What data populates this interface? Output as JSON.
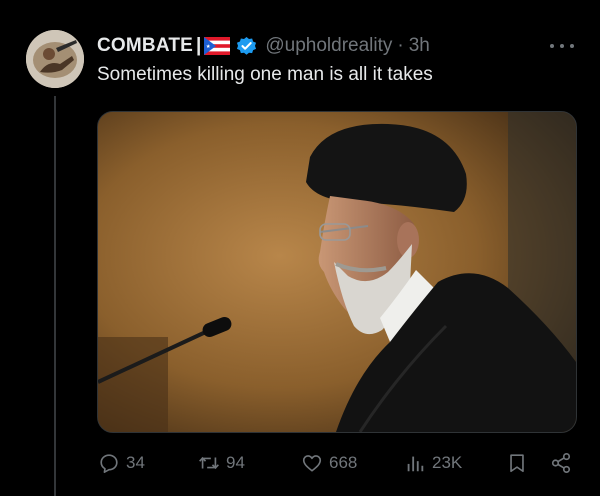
{
  "colors": {
    "background": "#000000",
    "text_primary": "#e7e9ea",
    "text_secondary": "#71767b",
    "verified_badge": "#1d9bf0"
  },
  "author": {
    "display_name": "COMBATE",
    "separator": "|",
    "flag": "puerto-rico-flag",
    "verified": true,
    "handle": "@upholdreality",
    "time_separator": "·",
    "timestamp": "3h"
  },
  "tweet": {
    "text": "Sometimes killing one man is all it takes"
  },
  "media": {
    "type": "photo"
  },
  "actions": {
    "reply_count": "34",
    "retweet_count": "94",
    "like_count": "668",
    "view_count": "23K"
  },
  "icons": {
    "reply": "reply-icon",
    "retweet": "retweet-icon",
    "like": "heart-icon",
    "views": "views-icon",
    "bookmark": "bookmark-icon",
    "share": "share-icon",
    "more": "more-icon"
  }
}
